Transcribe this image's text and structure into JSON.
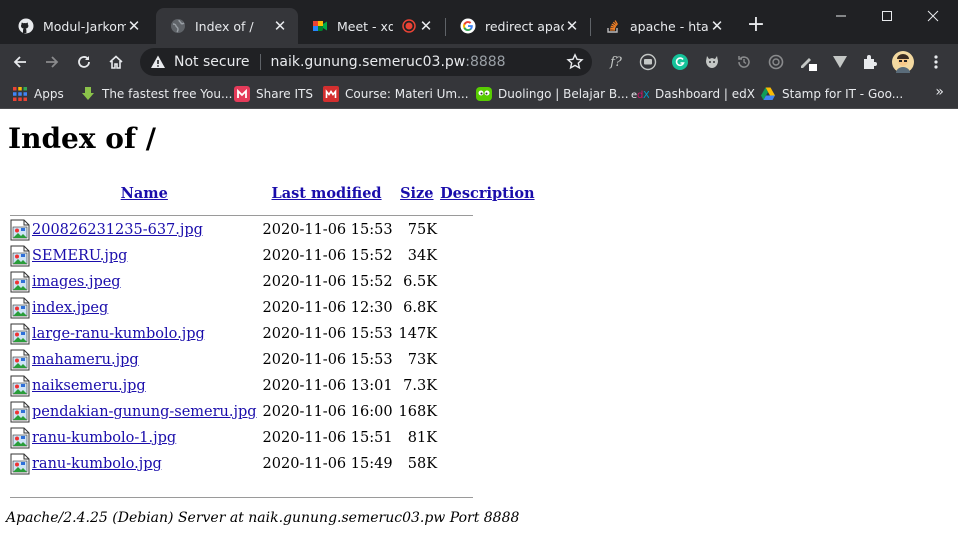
{
  "browser": {
    "tabs": [
      {
        "title": "Modul-Jarkom/",
        "icon": "github-icon"
      },
      {
        "title": "Index of /",
        "icon": "globe-icon",
        "active": true
      },
      {
        "title": "Meet - xdt",
        "icon": "google-meet-icon"
      },
      {
        "title": "redirect apache",
        "icon": "google-icon"
      },
      {
        "title": "apache - htacc",
        "icon": "stackoverflow-icon"
      }
    ],
    "address_bar": {
      "security": "Not secure",
      "host": "naik.gunung.semeruc03.pw",
      "port": ":8888"
    },
    "bookmarks": [
      {
        "label": "Apps",
        "icon": "apps-grid-icon"
      },
      {
        "label": "The fastest free You...",
        "icon": "download-arrow-icon"
      },
      {
        "label": "Share ITS",
        "icon": "share-its-icon"
      },
      {
        "label": "Course: Materi Um...",
        "icon": "course-icon"
      },
      {
        "label": "Duolingo | Belajar B...",
        "icon": "duolingo-icon"
      },
      {
        "label": "Dashboard | edX",
        "icon": "edx-icon"
      },
      {
        "label": "Stamp for IT - Goo...",
        "icon": "google-drive-icon"
      }
    ],
    "bookmarks_more": "»"
  },
  "page": {
    "heading": "Index of /",
    "columns": {
      "name": "Name",
      "modified": "Last modified",
      "size": "Size",
      "description": "Description"
    },
    "files": [
      {
        "name": "200826231235-637.jpg",
        "modified": "2020-11-06 15:53",
        "size": "75K"
      },
      {
        "name": "SEMERU.jpg",
        "modified": "2020-11-06 15:52",
        "size": "34K"
      },
      {
        "name": "images.jpeg",
        "modified": "2020-11-06 15:52",
        "size": "6.5K"
      },
      {
        "name": "index.jpeg",
        "modified": "2020-11-06 12:30",
        "size": "6.8K"
      },
      {
        "name": "large-ranu-kumbolo.jpg",
        "modified": "2020-11-06 15:53",
        "size": "147K"
      },
      {
        "name": "mahameru.jpg",
        "modified": "2020-11-06 15:53",
        "size": "73K"
      },
      {
        "name": "naiksemeru.jpg",
        "modified": "2020-11-06 13:01",
        "size": "7.3K"
      },
      {
        "name": "pendakian-gunung-semeru.jpg",
        "modified": "2020-11-06 16:00",
        "size": "168K"
      },
      {
        "name": "ranu-kumbolo-1.jpg",
        "modified": "2020-11-06 15:51",
        "size": "81K"
      },
      {
        "name": "ranu-kumbolo.jpg",
        "modified": "2020-11-06 15:49",
        "size": "58K"
      }
    ],
    "footer": "Apache/2.4.25 (Debian) Server at naik.gunung.semeruc03.pw Port 8888"
  }
}
